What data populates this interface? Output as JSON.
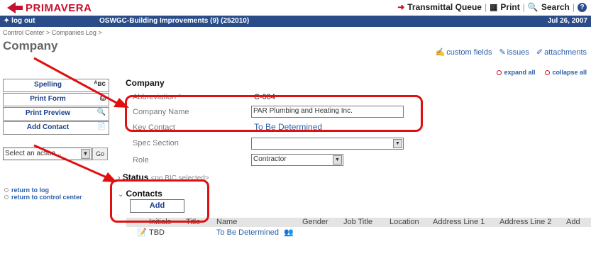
{
  "app": {
    "logo": "PRIMAVERA",
    "top_links": {
      "transmittal": "Transmittal Queue",
      "print": "Print",
      "search": "Search"
    },
    "logout": "log out",
    "project": "OSWGC-Building Improvements (9) (252010)",
    "date": "Jul 26, 2007"
  },
  "breadcrumb": "Control Center > Companies Log >",
  "page_title": "Company",
  "right_links": [
    "custom fields",
    "issues",
    "attachments"
  ],
  "expand_all": "expand all",
  "collapse_all": "collapse all",
  "left_buttons": [
    {
      "label": "Spelling",
      "icon": "spelling-icon",
      "glyph": "ᴬʙᴄ"
    },
    {
      "label": "Print Form",
      "icon": "printer-icon",
      "glyph": "⎙"
    },
    {
      "label": "Print Preview",
      "icon": "print-preview-icon",
      "glyph": "🔍"
    },
    {
      "label": "Add Contact",
      "icon": "add-contact-icon",
      "glyph": "📄"
    }
  ],
  "action_select": {
    "value": "Select an action...",
    "go": "Go"
  },
  "left_links": [
    "return to log",
    "return to control center"
  ],
  "company": {
    "section_title": "Company",
    "abbreviation_label": "Abbreviation *",
    "abbreviation_value": "C-004",
    "name_label": "Company Name",
    "name_value": "PAR Plumbing and Heating Inc.",
    "key_contact_label": "Key Contact",
    "key_contact_value": "To Be Determined",
    "spec_label": "Spec Section",
    "spec_value": "",
    "role_label": "Role",
    "role_value": "Contractor"
  },
  "status_section": {
    "title": "Status",
    "note": "<no BIC selected>"
  },
  "contacts": {
    "title": "Contacts",
    "add_label": "Add",
    "columns": [
      "Initials",
      "Title",
      "Name",
      "Gender",
      "Job Title",
      "Location",
      "Address Line 1",
      "Address Line 2",
      "Add"
    ],
    "rows": [
      {
        "initials": "TBD",
        "title": "",
        "name": "To Be Determined"
      }
    ]
  },
  "colors": {
    "brand": "#c8102e",
    "header_bar": "#2a4d8a",
    "link": "#2a5fa8",
    "highlight": "#e01010"
  }
}
